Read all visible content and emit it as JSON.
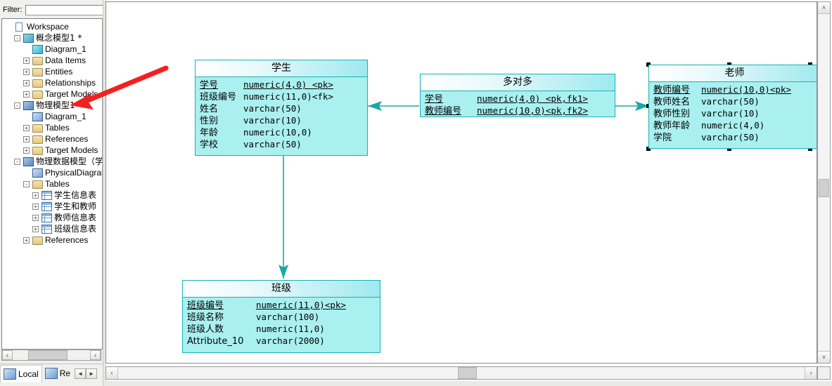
{
  "browser": {
    "filter": {
      "label": "Filter:",
      "value": "",
      "placeholder": ""
    },
    "tree": [
      {
        "label": "Workspace",
        "depth": 0,
        "icon": "workspace-icon",
        "expander": ""
      },
      {
        "label": "概念模型1 *",
        "depth": 1,
        "icon": "conceptual-model-icon",
        "expander": "-"
      },
      {
        "label": "Diagram_1",
        "depth": 2,
        "icon": "diagram-icon",
        "expander": ""
      },
      {
        "label": "Data Items",
        "depth": 2,
        "icon": "folder-icon",
        "expander": "+"
      },
      {
        "label": "Entities",
        "depth": 2,
        "icon": "folder-icon",
        "expander": "+"
      },
      {
        "label": "Relationships",
        "depth": 2,
        "icon": "folder-icon",
        "expander": "+"
      },
      {
        "label": "Target Models",
        "depth": 2,
        "icon": "folder-icon",
        "expander": "+"
      },
      {
        "label": "物理模型1 *",
        "depth": 1,
        "icon": "physical-model-icon",
        "expander": "-"
      },
      {
        "label": "Diagram_1",
        "depth": 2,
        "icon": "physical-diagram-icon",
        "expander": ""
      },
      {
        "label": "Tables",
        "depth": 2,
        "icon": "folder-icon",
        "expander": "+"
      },
      {
        "label": "References",
        "depth": 2,
        "icon": "folder-icon",
        "expander": "+"
      },
      {
        "label": "Target Models",
        "depth": 2,
        "icon": "folder-icon",
        "expander": "+"
      },
      {
        "label": "物理数据模型（学·",
        "depth": 1,
        "icon": "physical-model-icon",
        "expander": "-"
      },
      {
        "label": "PhysicalDiagram",
        "depth": 2,
        "icon": "physical-diagram-icon",
        "expander": ""
      },
      {
        "label": "Tables",
        "depth": 2,
        "icon": "folder-icon",
        "expander": "-"
      },
      {
        "label": "学生信息表",
        "depth": 3,
        "icon": "table-icon",
        "expander": "+"
      },
      {
        "label": "学生和教师",
        "depth": 3,
        "icon": "table-icon",
        "expander": "+"
      },
      {
        "label": "教师信息表",
        "depth": 3,
        "icon": "table-icon",
        "expander": "+"
      },
      {
        "label": "班级信息表",
        "depth": 3,
        "icon": "table-icon",
        "expander": "+"
      },
      {
        "label": "References",
        "depth": 2,
        "icon": "folder-icon",
        "expander": "+"
      }
    ],
    "tabs": [
      {
        "label": "Local",
        "icon": "local-repository-icon",
        "selected": true
      },
      {
        "label": "Re",
        "icon": "remote-repository-icon",
        "selected": false
      }
    ],
    "tab_nav": {
      "prev": "◄",
      "next": "►"
    },
    "hscroll": {
      "left": "‹",
      "right": "›"
    }
  },
  "diagram": {
    "entities": [
      {
        "name": "学生",
        "attributes": [
          {
            "name": "学号",
            "type": "numeric(4,0) <pk>",
            "pk": true
          },
          {
            "name": "班级编号",
            "type": "numeric(11,0)<fk>",
            "pk": false
          },
          {
            "name": "姓名",
            "type": "varchar(50)",
            "pk": false
          },
          {
            "name": "性别",
            "type": "varchar(10)",
            "pk": false
          },
          {
            "name": "年龄",
            "type": "numeric(10,0)",
            "pk": false
          },
          {
            "name": "学校",
            "type": "varchar(50)",
            "pk": false
          }
        ]
      },
      {
        "name": "多对多",
        "attributes": [
          {
            "name": "学号",
            "type": "numeric(4,0) <pk,fk1>",
            "pk": true
          },
          {
            "name": "教师编号",
            "type": "numeric(10,0)<pk,fk2>",
            "pk": true
          }
        ]
      },
      {
        "name": "老师",
        "attributes": [
          {
            "name": "教师编号",
            "type": "numeric(10,0)<pk>",
            "pk": true
          },
          {
            "name": "教师姓名",
            "type": "varchar(50)",
            "pk": false
          },
          {
            "name": "教师性别",
            "type": "varchar(10)",
            "pk": false
          },
          {
            "name": "教师年龄",
            "type": "numeric(4,0)",
            "pk": false
          },
          {
            "name": "学院",
            "type": "varchar(50)",
            "pk": false
          }
        ]
      },
      {
        "name": "班级",
        "attributes": [
          {
            "name": "班级编号",
            "type": "numeric(11,0)<pk>",
            "pk": true
          },
          {
            "name": "班级名称",
            "type": "varchar(100)",
            "pk": false
          },
          {
            "name": "班级人数",
            "type": "numeric(11,0)",
            "pk": false
          },
          {
            "name": "Attribute_10",
            "type": "varchar(2000)",
            "pk": false
          }
        ]
      }
    ],
    "colors": {
      "entity_fill": "#aaf0f0",
      "entity_border": "#19b2b2",
      "connector": "#1aa8a8",
      "annotation_arrow": "#f42020",
      "selection_handle": "#000000"
    },
    "scroll": {
      "up": "˄",
      "down": "˅",
      "left": "‹",
      "right": "›"
    }
  }
}
